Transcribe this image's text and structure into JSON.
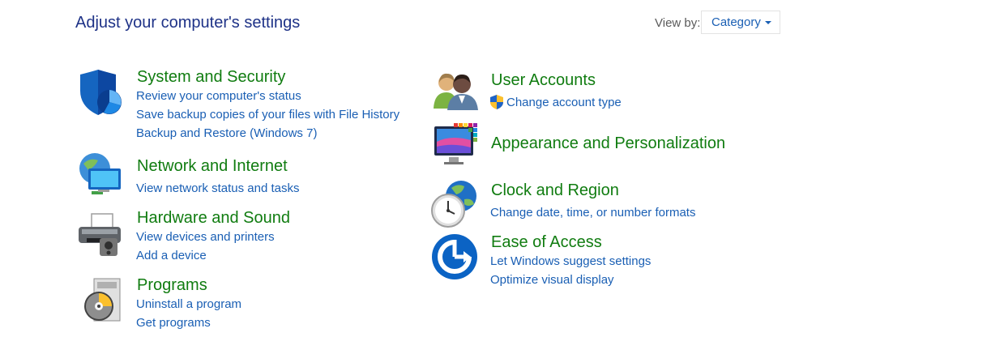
{
  "header": {
    "title": "Adjust your computer's settings",
    "view_by_label": "View by:",
    "view_by_value": "Category"
  },
  "categories": {
    "system_security": {
      "title": "System and Security",
      "icon": "security-shield-icon",
      "links": [
        "Review your computer's status",
        "Save backup copies of your files with File History",
        "Backup and Restore (Windows 7)"
      ]
    },
    "network_internet": {
      "title": "Network and Internet",
      "icon": "network-globe-icon",
      "links": [
        "View network status and tasks"
      ]
    },
    "hardware_sound": {
      "title": "Hardware and Sound",
      "icon": "printer-icon",
      "links": [
        "View devices and printers",
        "Add a device"
      ]
    },
    "programs": {
      "title": "Programs",
      "icon": "programs-disc-icon",
      "links": [
        "Uninstall a program",
        "Get programs"
      ]
    },
    "user_accounts": {
      "title": "User Accounts",
      "icon": "users-icon",
      "links": [
        "Change account type"
      ]
    },
    "appearance": {
      "title": "Appearance and Personalization",
      "icon": "monitor-palette-icon",
      "links": []
    },
    "clock_region": {
      "title": "Clock and Region",
      "icon": "clock-globe-icon",
      "links": [
        "Change date, time, or number formats"
      ]
    },
    "ease_access": {
      "title": "Ease of Access",
      "icon": "ease-of-access-icon",
      "links": [
        "Let Windows suggest settings",
        "Optimize visual display"
      ]
    }
  },
  "colors": {
    "title_blue": "#1e3287",
    "category_green": "#107c10",
    "link_blue": "#1a5fb4"
  }
}
